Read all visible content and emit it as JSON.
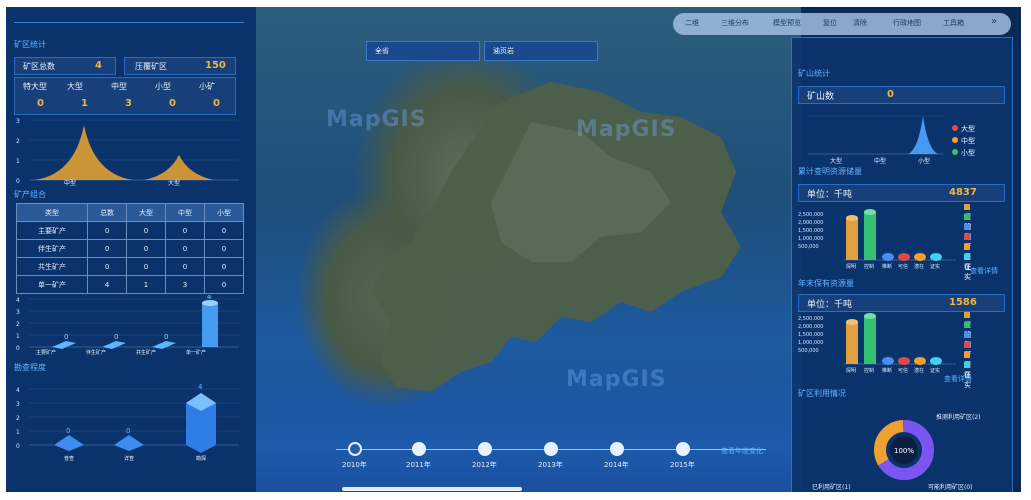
{
  "toolbar": {
    "items": [
      "二维",
      "三维分布",
      "模型预览",
      "复位",
      "清除",
      "行政地图",
      "工具箱"
    ],
    "more": "»"
  },
  "selects": {
    "region": "全省",
    "mineral": "油页岩"
  },
  "left": {
    "stats_title": "矿区统计",
    "total_label": "矿区总数",
    "total_value": "4",
    "press_label": "压覆矿区",
    "press_value": "150",
    "size_headers": [
      "特大型",
      "大型",
      "中型",
      "小型",
      "小矿"
    ],
    "size_values": [
      "0",
      "1",
      "3",
      "0",
      "0"
    ],
    "chart1_labels": [
      "中型",
      "大型"
    ],
    "chart1_yticks": [
      "3",
      "2",
      "1",
      "0"
    ],
    "combo_title": "矿产组合",
    "table_headers": [
      "类型",
      "总数",
      "大型",
      "中型",
      "小型"
    ],
    "table_rows": [
      [
        "主要矿产",
        "0",
        "0",
        "0",
        "0"
      ],
      [
        "伴生矿产",
        "0",
        "0",
        "0",
        "0"
      ],
      [
        "共生矿产",
        "0",
        "0",
        "0",
        "0"
      ],
      [
        "单一矿产",
        "4",
        "1",
        "3",
        "0"
      ]
    ],
    "chart2_values": [
      "0",
      "0",
      "0",
      "4"
    ],
    "chart2_labels": [
      "主要矿产",
      "伴生矿产",
      "共生矿产",
      "单一矿产"
    ],
    "chart2_yticks": [
      "4",
      "3",
      "2",
      "1",
      "0"
    ],
    "explore_title": "勘查程度",
    "chart3_values": [
      "0",
      "0",
      "4"
    ],
    "chart3_labels": [
      "普查",
      "详查",
      "勘探"
    ],
    "chart3_yticks": [
      "4",
      "3",
      "2",
      "1",
      "0"
    ]
  },
  "right": {
    "mine_title": "矿山统计",
    "mine_count_label": "矿山数",
    "mine_count_value": "0",
    "mine_legend": [
      "大型",
      "中型",
      "小型"
    ],
    "mine_xlabels": [
      "大型",
      "中型",
      "小型"
    ],
    "reserve_title": "累计查明资源储量",
    "unit1": "单位：千吨",
    "total1": "4837",
    "reserve_legend": [
      "探明",
      "控制",
      "推断",
      "可信",
      "潜在",
      "证实"
    ],
    "yticks": [
      "2,500,000",
      "2,000,000",
      "1,500,000",
      "1,000,000",
      "500,000"
    ],
    "detail1": "查看详情",
    "year_title": "年末保有资源量",
    "unit2": "单位：千吨",
    "total2": "1586",
    "detail2": "查看详情",
    "use_title": "矿区利用情况",
    "use_legend": [
      "已利用矿区(1)",
      "推测利用矿区(2)",
      "可能利用矿区(0)"
    ],
    "donut_center": "100%"
  },
  "timeline": {
    "years": [
      "2010年",
      "2011年",
      "2012年",
      "2013年",
      "2014年",
      "2015年"
    ],
    "link": "查看年度变化"
  },
  "watermark": "MapGIS"
}
